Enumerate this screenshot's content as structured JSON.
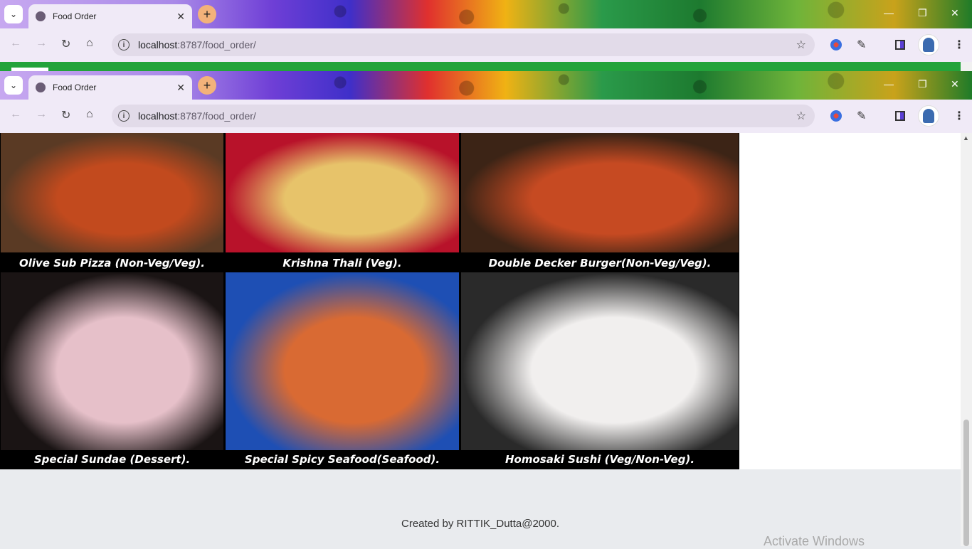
{
  "browser": {
    "tab_title": "Food Order",
    "tab_close": "✕",
    "new_tab": "+",
    "url_host": "localhost",
    "url_path": ":8787/food_order/",
    "win_minimize": "—",
    "win_restore": "❐",
    "win_close": "✕"
  },
  "menu": {
    "items": [
      {
        "name": "Olive Sub Pizza (Non-Veg/Veg).",
        "colors": [
          "#5a3a24",
          "#c24a1e"
        ]
      },
      {
        "name": "Krishna Thali (Veg).",
        "colors": [
          "#b8122a",
          "#e7c36a"
        ]
      },
      {
        "name": "Double Decker Burger(Non-Veg/Veg).",
        "colors": [
          "#3c2416",
          "#c64a22"
        ]
      },
      {
        "name": "Special Sundae (Dessert).",
        "colors": [
          "#1a1414",
          "#e6c0c9"
        ]
      },
      {
        "name": "Special Spicy Seafood(Seafood).",
        "colors": [
          "#1e4fb4",
          "#d96a33"
        ]
      },
      {
        "name": "Homosaki Sushi (Veg/Non-Veg).",
        "colors": [
          "#2a2a2a",
          "#f1efee"
        ]
      }
    ]
  },
  "footer": {
    "credit": "Created by RITTIK_Dutta@2000."
  },
  "os": {
    "watermark": "Activate Windows"
  }
}
